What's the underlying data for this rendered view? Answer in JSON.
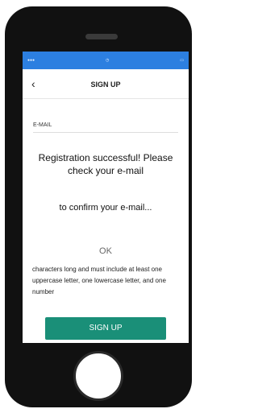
{
  "header": {
    "title": "SIGN UP"
  },
  "form": {
    "email_label": "E-MAIL"
  },
  "dialog": {
    "message": "Registration successful! Please check your e-mail",
    "message_2": "to confirm your e-mail...",
    "ok_label": "OK"
  },
  "password_hint": "characters long and must include at least one uppercase letter, one lowercase letter, and one number",
  "signup_button": "SIGN UP",
  "colors": {
    "accent": "#1a8f78",
    "status_bar": "#2c7fe0"
  }
}
